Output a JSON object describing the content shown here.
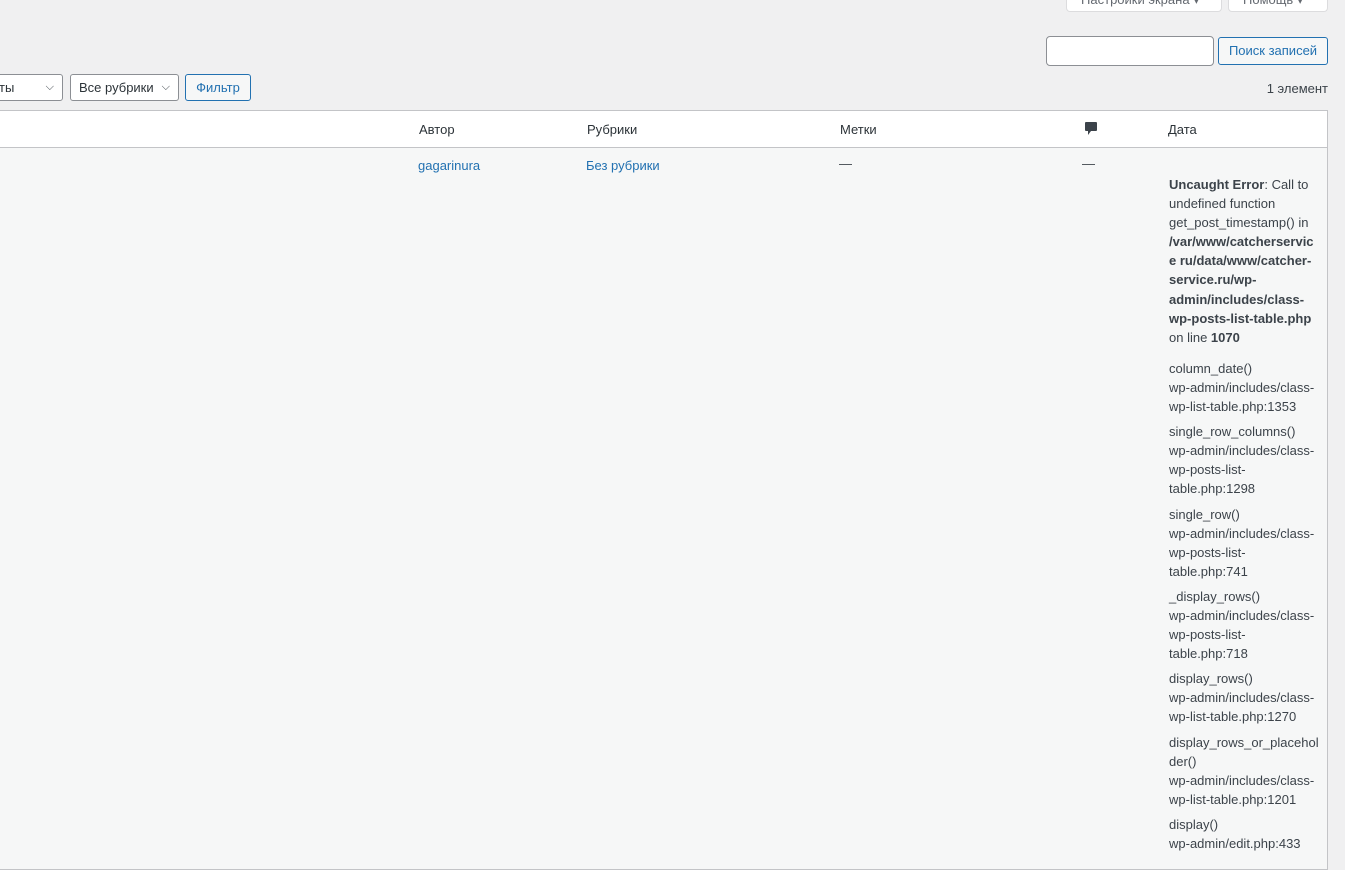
{
  "top_buttons": {
    "screen_options": "Настройки экрана ▾",
    "help": "Помощь ▾"
  },
  "search": {
    "value": "",
    "button": "Поиск записей"
  },
  "filters": {
    "dates_partial": "ты",
    "categories": "Все рубрики",
    "filter_button": "Фильтр"
  },
  "count": "1 элемент",
  "columns": {
    "author": "Автор",
    "categories": "Рубрики",
    "tags": "Метки",
    "comments_icon": "comment-icon",
    "date": "Дата"
  },
  "row": {
    "author": "gagarinura",
    "categories": "Без рубрики",
    "tags": "—",
    "comments": "—"
  },
  "error": {
    "label": "Uncaught Error",
    "message": ": Call to undefined function get_post_timestamp() in ",
    "file": "/var/www/catcherservice ru/data/www/catcher-service.ru/wp-admin/includes/class-wp-posts-list-table.php",
    "on_line": " on line ",
    "line": "1070",
    "trace": [
      {
        "fn": "column_date()",
        "loc": "wp-admin/includes/class-wp-list-table.php:1353"
      },
      {
        "fn": "single_row_columns()",
        "loc": "wp-admin/includes/class-wp-posts-list-table.php:1298"
      },
      {
        "fn": "single_row()",
        "loc": "wp-admin/includes/class-wp-posts-list-table.php:741"
      },
      {
        "fn": "_display_rows()",
        "loc": "wp-admin/includes/class-wp-posts-list-table.php:718"
      },
      {
        "fn": "display_rows()",
        "loc": "wp-admin/includes/class-wp-list-table.php:1270"
      },
      {
        "fn": "display_rows_or_placeholder()",
        "loc": "wp-admin/includes/class-wp-list-table.php:1201"
      },
      {
        "fn": "display()",
        "loc": "wp-admin/edit.php:433"
      }
    ]
  }
}
